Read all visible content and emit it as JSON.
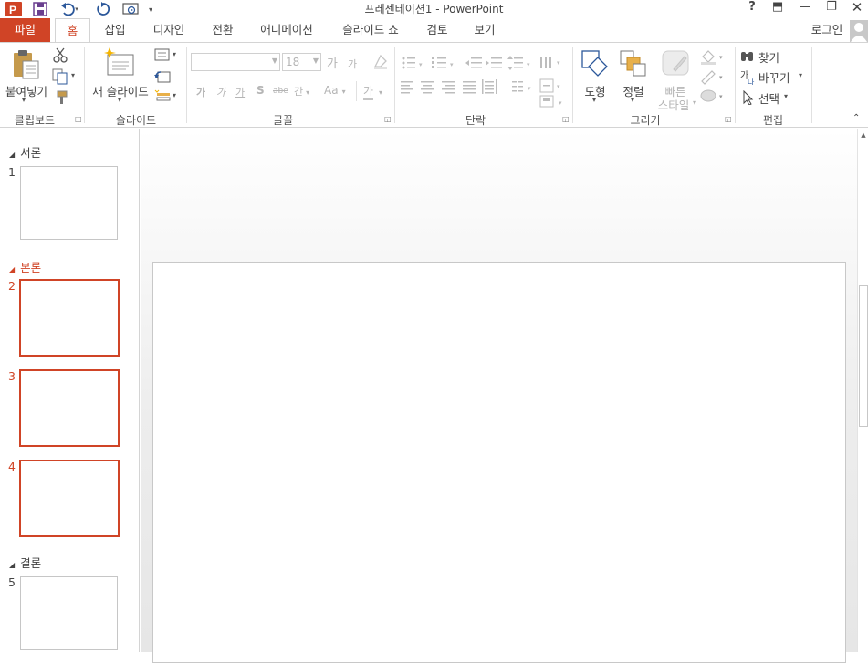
{
  "window": {
    "title": "프레젠테이션1 - PowerPoint",
    "help": "?",
    "minimize": "—",
    "restore": "❐",
    "ribbon_options": "⬒"
  },
  "tabs": [
    {
      "label": "파일"
    },
    {
      "label": "홈"
    },
    {
      "label": "삽입"
    },
    {
      "label": "디자인"
    },
    {
      "label": "전환"
    },
    {
      "label": "애니메이션"
    },
    {
      "label": "슬라이드 쇼"
    },
    {
      "label": "검토"
    },
    {
      "label": "보기"
    }
  ],
  "account": {
    "login_label": "로그인"
  },
  "ribbon": {
    "clipboard": {
      "label": "클립보드",
      "paste_label": "붙여넣기"
    },
    "slides": {
      "label": "슬라이드",
      "new_slide_label": "새 슬라이드"
    },
    "font": {
      "label": "글꼴",
      "font_name": "",
      "font_size": "18",
      "grow": "가",
      "shrink": "가",
      "bold": "가",
      "italic": "가",
      "underline": "가",
      "shadow": "S",
      "strike": "abe",
      "spacing": "간",
      "case": "Aa",
      "color": "가"
    },
    "paragraph": {
      "label": "단락"
    },
    "drawing": {
      "label": "그리기",
      "shapes_label": "도형",
      "arrange_label": "정렬",
      "quick_styles_label_1": "빠른",
      "quick_styles_label_2": "스타일"
    },
    "editing": {
      "label": "편집",
      "find_label": "찾기",
      "replace_label": "바꾸기",
      "select_label": "선택"
    }
  },
  "thumbnails": {
    "sections": [
      {
        "name": "서론"
      },
      {
        "name": "본론"
      },
      {
        "name": "결론"
      }
    ],
    "slides": [
      {
        "number": "1"
      },
      {
        "number": "2"
      },
      {
        "number": "3"
      },
      {
        "number": "4"
      },
      {
        "number": "5"
      }
    ]
  },
  "colors": {
    "accent": "#d04426",
    "file_tab": "#d04426"
  }
}
